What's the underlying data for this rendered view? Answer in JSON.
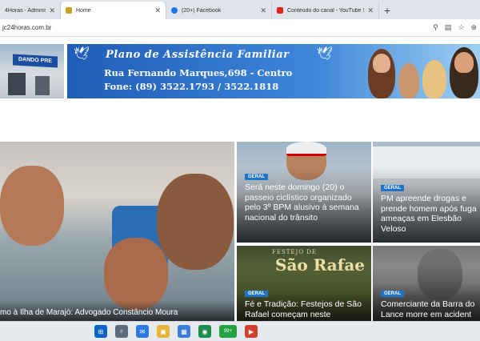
{
  "browser": {
    "tabs": [
      {
        "label": "4Horas - Administr...",
        "color": "#4a4a4a",
        "close": "✕"
      },
      {
        "label": "Home",
        "color": "#c9a227",
        "close": "✕"
      },
      {
        "label": "(20+) Facebook",
        "color": "#1877f2",
        "close": "✕"
      },
      {
        "label": "Conteúdo do canal - YouTube Stu...",
        "color": "#e62117",
        "close": "✕"
      }
    ],
    "new_tab_icon": "+",
    "url": "jc24horas.com.br",
    "address_icons": [
      "⚲",
      "▤",
      "☆",
      "⊕"
    ]
  },
  "banner": {
    "sign": "DANDO PRE",
    "title": "Plano de Assistência Familiar",
    "address": "Rua Fernando Marques,698 - Centro",
    "phone": "Fone: (89) 3522.1793 / 3522.1818",
    "dove_icon": "🕊"
  },
  "hero": {
    "caption": "mo à Ilha de Marajó: Advogado Constâncio Moura"
  },
  "cards": [
    {
      "badge": "GERAL",
      "title": "Será neste domingo (20) o passeio ciclístico organizado pelo 3º BPM alusivo à semana nacional do trânsito"
    },
    {
      "badge": "GERAL",
      "title": "PM apreende drogas e prende homem após fuga ameaças em Elesbão Veloso"
    },
    {
      "badge": "GERAL",
      "title": "Fé e Tradição: Festejos de São Rafael começam neste",
      "poster_top": "FESTEJO DE",
      "poster_main": "São Rafae"
    },
    {
      "badge": "GERAL",
      "title": "Comerciante da Barra do Lance morre em acident"
    }
  ],
  "taskbar": {
    "items": [
      "⊞",
      "⌕",
      "✉",
      "▣",
      "▦",
      "◉",
      "◎",
      "▶"
    ],
    "badge": "99+"
  }
}
